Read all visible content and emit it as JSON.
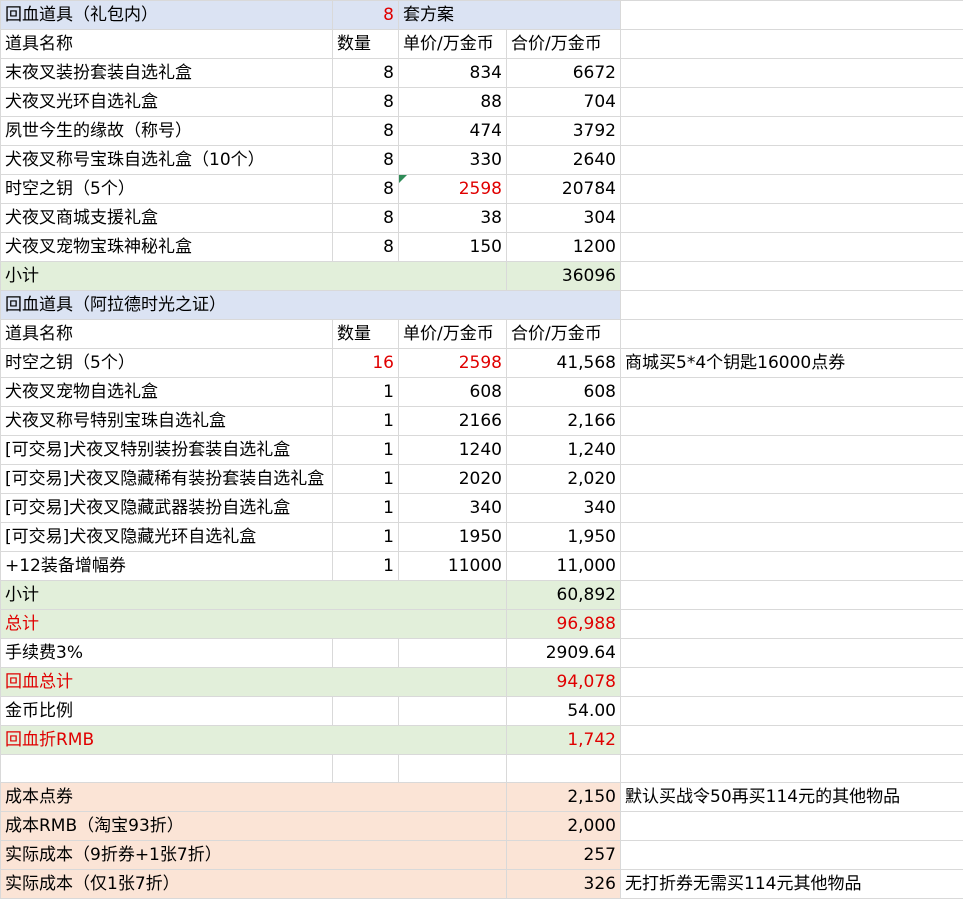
{
  "section1": {
    "title": "回血道具（礼包内）",
    "count": "8",
    "plan_label": "套方案",
    "headers": [
      "道具名称",
      "数量",
      "单价/万金币",
      "合价/万金币"
    ],
    "rows": [
      {
        "name": "末夜叉装扮套装自选礼盒",
        "qty": "8",
        "unit": "834",
        "total": "6672"
      },
      {
        "name": "犬夜叉光环自选礼盒",
        "qty": "8",
        "unit": "88",
        "total": "704"
      },
      {
        "name": "夙世今生的缘故（称号）",
        "qty": "8",
        "unit": "474",
        "total": "3792"
      },
      {
        "name": "犬夜叉称号宝珠自选礼盒（10个）",
        "qty": "8",
        "unit": "330",
        "total": "2640"
      },
      {
        "name": "时空之钥（5个）",
        "qty": "8",
        "unit": "2598",
        "total": "20784"
      },
      {
        "name": "犬夜叉商城支援礼盒",
        "qty": "8",
        "unit": "38",
        "total": "304"
      },
      {
        "name": "犬夜叉宠物宝珠神秘礼盒",
        "qty": "8",
        "unit": "150",
        "total": "1200"
      }
    ],
    "subtotal_label": "小计",
    "subtotal_value": "36096"
  },
  "section2": {
    "title": "回血道具（阿拉德时光之证）",
    "headers": [
      "道具名称",
      "数量",
      "单价/万金币",
      "合价/万金币"
    ],
    "rows": [
      {
        "name": "时空之钥（5个）",
        "qty": "16",
        "unit": "2598",
        "total": "41,568",
        "note": "商城买5*4个钥匙16000点券"
      },
      {
        "name": "犬夜叉宠物自选礼盒",
        "qty": "1",
        "unit": "608",
        "total": "608",
        "note": ""
      },
      {
        "name": "犬夜叉称号特别宝珠自选礼盒",
        "qty": "1",
        "unit": "2166",
        "total": "2,166",
        "note": ""
      },
      {
        "name": "[可交易]犬夜叉特别装扮套装自选礼盒",
        "qty": "1",
        "unit": "1240",
        "total": "1,240",
        "note": ""
      },
      {
        "name": "[可交易]犬夜叉隐藏稀有装扮套装自选礼盒",
        "qty": "1",
        "unit": "2020",
        "total": "2,020",
        "note": ""
      },
      {
        "name": "[可交易]犬夜叉隐藏武器装扮自选礼盒",
        "qty": "1",
        "unit": "340",
        "total": "340",
        "note": ""
      },
      {
        "name": "[可交易]犬夜叉隐藏光环自选礼盒",
        "qty": "1",
        "unit": "1950",
        "total": "1,950",
        "note": ""
      },
      {
        "name": "+12装备增幅券",
        "qty": "1",
        "unit": "11000",
        "total": "11,000",
        "note": ""
      }
    ],
    "subtotal_label": "小计",
    "subtotal_value": "60,892"
  },
  "summary": {
    "total_label": "总计",
    "total_value": "96,988",
    "fee_label": "手续费3%",
    "fee_value": "2909.64",
    "return_label": "回血总计",
    "return_value": "94,078",
    "ratio_label": "金币比例",
    "ratio_value": "54.00",
    "rmb_label": "回血折RMB",
    "rmb_value": "1,742"
  },
  "cost": {
    "rows": [
      {
        "label": "成本点券",
        "value": "2,150",
        "note": "默认买战令50再买114元的其他物品"
      },
      {
        "label": "成本RMB（淘宝93折）",
        "value": "2,000",
        "note": ""
      },
      {
        "label": "实际成本（9折券+1张7折）",
        "value": "257",
        "note": ""
      },
      {
        "label": "实际成本（仅1张7折）",
        "value": "326",
        "note": "无打折券无需买114元其他物品"
      }
    ]
  },
  "colors": {
    "header_blue": "#dbe3f3",
    "subtotal_green": "#e2efda",
    "cost_peach": "#fbe4d6",
    "highlight_red": "#e00000"
  }
}
